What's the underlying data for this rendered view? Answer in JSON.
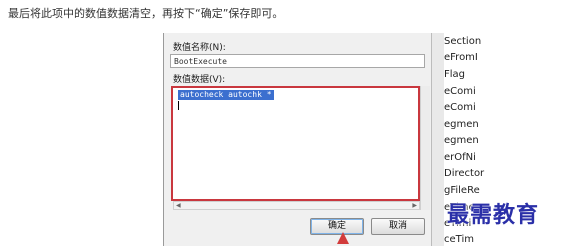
{
  "instruction": "最后将此项中的数值数据清空，再按下“确定”保存即可。",
  "dialog": {
    "value_name_label": "数值名称(N):",
    "value_name": "BootExecute",
    "value_data_label": "数值数据(V):",
    "value_data": "autocheck autochk *",
    "ok_button": "确定",
    "cancel_button": "取消"
  },
  "side_list": [
    "Section",
    "eFromI",
    "Flag",
    "eComi",
    "eComi",
    "egmen",
    "egmen",
    "erOfNi",
    "Director",
    "gFileRe",
    "eTime",
    "eTimi",
    "ceTim"
  ],
  "watermark": "最需教育"
}
